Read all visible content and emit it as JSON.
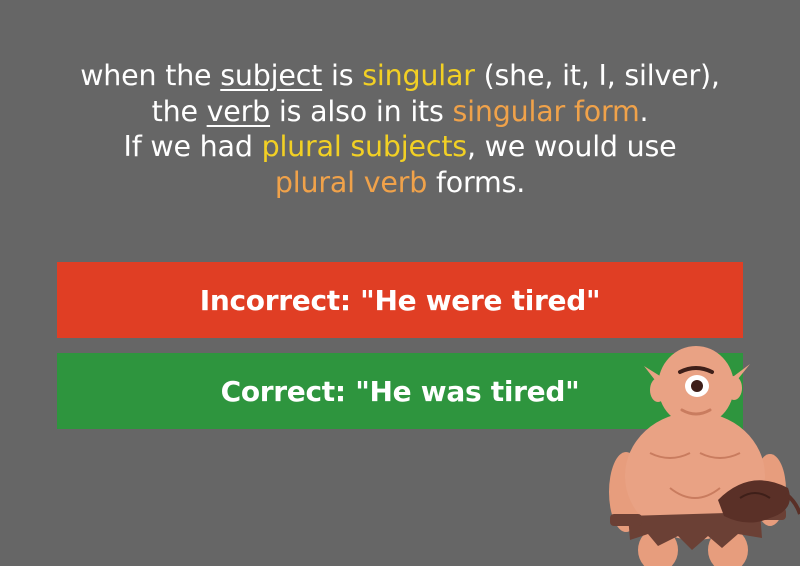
{
  "explanation": {
    "line1": [
      "when the ",
      "subject",
      " is ",
      "singular",
      " (she, it, I, silver),"
    ],
    "line2": [
      "the ",
      "verb",
      " is also in its ",
      "singular form",
      "."
    ],
    "line3": [
      "If we had ",
      "plural subjects",
      ", we would use"
    ],
    "line4": [
      "plural verb",
      " forms."
    ]
  },
  "examples": {
    "incorrect": "Incorrect: \"He were tired\"",
    "correct": "Correct: \"He was tired\""
  },
  "colors": {
    "background": "#666666",
    "incorrect_bg": "#e03e24",
    "correct_bg": "#2e953e",
    "highlight_yellow": "#f2d024",
    "highlight_orange": "#f0a24a"
  },
  "illustration": {
    "icon": "cyclops-ogre-icon"
  }
}
